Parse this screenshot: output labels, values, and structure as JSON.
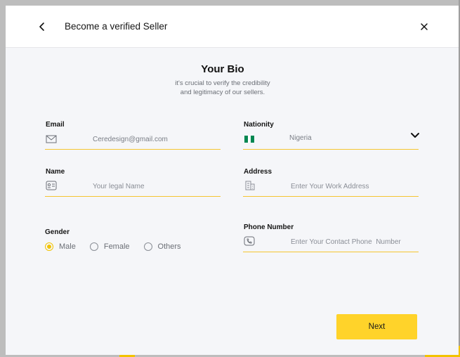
{
  "header": {
    "title": "Become a verified Seller",
    "back_icon": "chevron-left-icon",
    "close_icon": "close-icon"
  },
  "section": {
    "title": "Your Bio",
    "subtitle_line1": "it's crucial to verify the credibility",
    "subtitle_line2": "and legitimacy of our sellers."
  },
  "fields": {
    "email": {
      "label": "Email",
      "value": "Ceredesign@gmail.com",
      "icon": "envelope-icon"
    },
    "nationality": {
      "label": "Nationity",
      "value": "Nigeria",
      "icon": "nigeria-flag-icon",
      "dropdown_icon": "chevron-down-icon"
    },
    "name": {
      "label": "Name",
      "placeholder": "Your legal Name",
      "icon": "id-card-icon"
    },
    "address": {
      "label": "Address",
      "placeholder": "Enter Your Work Address",
      "icon": "building-icon"
    },
    "phone": {
      "label": "Phone Number",
      "placeholder": "Enter Your Contact Phone  Number",
      "icon": "phone-icon"
    }
  },
  "gender": {
    "label": "Gender",
    "options": [
      {
        "label": "Male",
        "selected": true
      },
      {
        "label": "Female",
        "selected": false
      },
      {
        "label": "Others",
        "selected": false
      }
    ]
  },
  "actions": {
    "next_label": "Next"
  },
  "colors": {
    "accent": "#f5c531",
    "button": "#ffd32a",
    "flag_green": "#008751"
  }
}
